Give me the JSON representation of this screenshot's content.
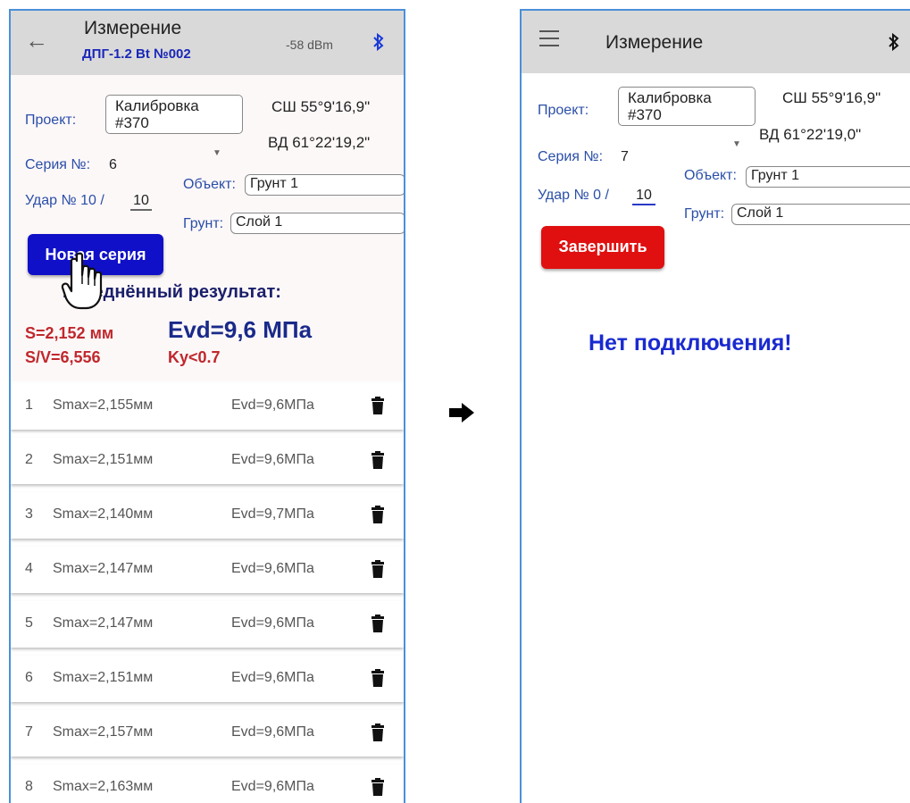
{
  "left": {
    "title": "Измерение",
    "device": "ДПГ-1.2 Bt №002",
    "signal": "-58 dBm",
    "project_label": "Проект:",
    "project_value": "Калибровка\n#370",
    "lat": "СШ 55°9'16,9\"",
    "lon": "ВД 61°22'19,2\"",
    "series_label": "Серия №:",
    "series_value": "6",
    "object_label": "Объект:",
    "object_value": "Грунт 1",
    "strike_label": "Удар № 10 /",
    "strike_max": "10",
    "soil_label": "Грунт:",
    "soil_value": "Слой 1",
    "new_series_button": "Новая серия",
    "result_title": "Усреднённый результат:",
    "s_value": "S=2,152 мм",
    "evd_value": "Evd=9,6 МПа",
    "sv_value": "S/V=6,556",
    "ky_value": "Ky<0.7",
    "rows": [
      {
        "n": "1",
        "smax": "Smax=2,155мм",
        "evd": "Evd=9,6МПа"
      },
      {
        "n": "2",
        "smax": "Smax=2,151мм",
        "evd": "Evd=9,6МПа"
      },
      {
        "n": "3",
        "smax": "Smax=2,140мм",
        "evd": "Evd=9,7МПа"
      },
      {
        "n": "4",
        "smax": "Smax=2,147мм",
        "evd": "Evd=9,6МПа"
      },
      {
        "n": "5",
        "smax": "Smax=2,147мм",
        "evd": "Evd=9,6МПа"
      },
      {
        "n": "6",
        "smax": "Smax=2,151мм",
        "evd": "Evd=9,6МПа"
      },
      {
        "n": "7",
        "smax": "Smax=2,157мм",
        "evd": "Evd=9,6МПа"
      },
      {
        "n": "8",
        "smax": "Smax=2,163мм",
        "evd": "Evd=9,6МПа"
      }
    ]
  },
  "right": {
    "title": "Измерение",
    "project_label": "Проект:",
    "project_value": "Калибровка\n#370",
    "lat": "СШ 55°9'16,9\"",
    "lon": "ВД 61°22'19,0\"",
    "series_label": "Серия №:",
    "series_value": "7",
    "object_label": "Объект:",
    "object_value": "Грунт 1",
    "strike_label": "Удар № 0 /",
    "strike_max": "10",
    "soil_label": "Грунт:",
    "soil_value": "Слой 1",
    "finish_button": "Завершить",
    "no_connection": "Нет подключения!"
  },
  "colors": {
    "appbar": "#d9d9d9",
    "blue_button": "#1010c8",
    "red_button": "#e01010",
    "label_blue": "#2a4ea8",
    "result_red": "#c0282d"
  },
  "icons": [
    "back-arrow-icon",
    "menu-icon",
    "bluetooth-icon",
    "dropdown-icon",
    "trash-icon",
    "hand-pointer-icon",
    "arrow-right-icon"
  ]
}
